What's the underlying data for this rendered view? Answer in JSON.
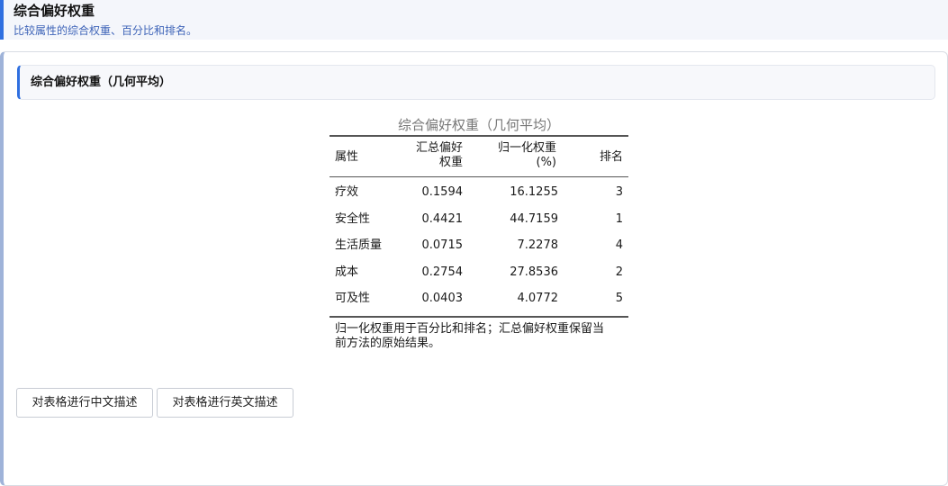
{
  "header": {
    "title": "综合偏好权重",
    "subtitle": "比较属性的综合权重、百分比和排名。"
  },
  "section": {
    "title": "综合偏好权重（几何平均）"
  },
  "table": {
    "caption": "综合偏好权重（几何平均）",
    "columns": {
      "attribute": "属性",
      "pref_line1": "汇总偏好",
      "pref_line2": "权重",
      "norm_line1": "归一化权重",
      "norm_line2": "(%)",
      "rank": "排名"
    },
    "rows": [
      {
        "attribute": "疗效",
        "pref": "0.1594",
        "norm": "16.1255",
        "rank": "3"
      },
      {
        "attribute": "安全性",
        "pref": "0.4421",
        "norm": "44.7159",
        "rank": "1"
      },
      {
        "attribute": "生活质量",
        "pref": "0.0715",
        "norm": "7.2278",
        "rank": "4"
      },
      {
        "attribute": "成本",
        "pref": "0.2754",
        "norm": "27.8536",
        "rank": "2"
      },
      {
        "attribute": "可及性",
        "pref": "0.0403",
        "norm": "4.0772",
        "rank": "5"
      }
    ],
    "note": "归一化权重用于百分比和排名；汇总偏好权重保留当前方法的原始结果。"
  },
  "buttons": {
    "describe_zh": "对表格进行中文描述",
    "describe_en": "对表格进行英文描述"
  },
  "colors": {
    "accent": "#2f6fe0",
    "subtitle": "#3e64b8",
    "header_bg": "#f4f6fb"
  }
}
